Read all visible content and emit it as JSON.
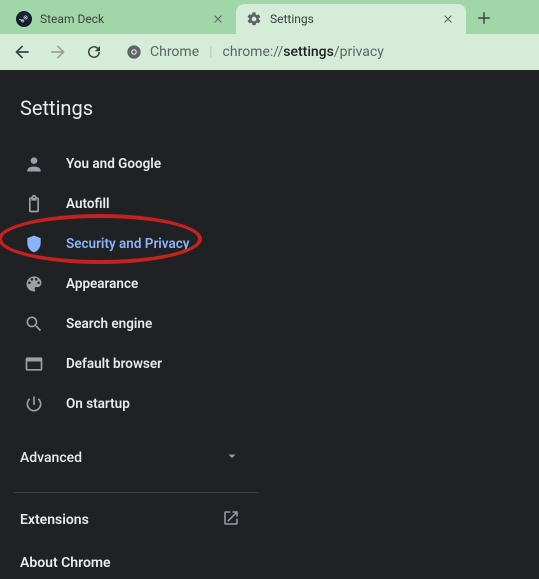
{
  "tabs": [
    {
      "title": "Steam Deck",
      "active": false
    },
    {
      "title": "Settings",
      "active": true
    }
  ],
  "omnibox": {
    "chip_label": "Chrome",
    "url_prefix": "chrome://",
    "url_strong": "settings",
    "url_suffix": "/privacy"
  },
  "page": {
    "title": "Settings",
    "nav": [
      {
        "key": "you-and-google",
        "label": "You and Google"
      },
      {
        "key": "autofill",
        "label": "Autofill"
      },
      {
        "key": "security-and-privacy",
        "label": "Security and Privacy",
        "active": true
      },
      {
        "key": "appearance",
        "label": "Appearance"
      },
      {
        "key": "search-engine",
        "label": "Search engine"
      },
      {
        "key": "default-browser",
        "label": "Default browser"
      },
      {
        "key": "on-startup",
        "label": "On startup"
      }
    ],
    "advanced_label": "Advanced",
    "footer": [
      {
        "key": "extensions",
        "label": "Extensions",
        "external": true
      },
      {
        "key": "about-chrome",
        "label": "About Chrome",
        "external": false
      }
    ]
  },
  "colors": {
    "accent": "#8ab4f8",
    "annotation": "#c5221f",
    "tab_bg_active": "#d5ecd8",
    "tab_strip_bg": "#a1d6a8",
    "page_bg": "#202124"
  }
}
